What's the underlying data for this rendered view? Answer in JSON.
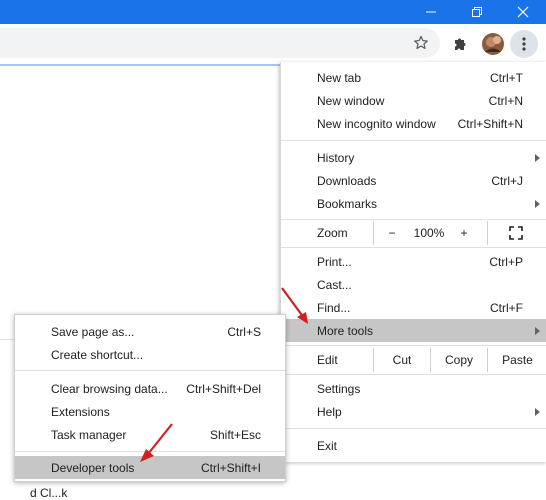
{
  "window": {
    "minimize_icon": "minimize-icon",
    "restore_icon": "restore-icon",
    "close_icon": "close-icon"
  },
  "toolbar": {
    "star_icon": "bookmark-star-icon",
    "extensions_icon": "extensions-puzzle-icon",
    "profile_icon": "avatar",
    "menu_icon": "three-dot-menu-icon"
  },
  "page": {
    "partial_text": "d Cl...k"
  },
  "menu": {
    "new_tab": {
      "label": "New tab",
      "shortcut": "Ctrl+T"
    },
    "new_window": {
      "label": "New window",
      "shortcut": "Ctrl+N"
    },
    "new_incognito": {
      "label": "New incognito window",
      "shortcut": "Ctrl+Shift+N"
    },
    "history": {
      "label": "History"
    },
    "downloads": {
      "label": "Downloads",
      "shortcut": "Ctrl+J"
    },
    "bookmarks": {
      "label": "Bookmarks"
    },
    "zoom": {
      "label": "Zoom",
      "minus": "−",
      "value": "100%",
      "plus": "+"
    },
    "print": {
      "label": "Print...",
      "shortcut": "Ctrl+P"
    },
    "cast": {
      "label": "Cast..."
    },
    "find": {
      "label": "Find...",
      "shortcut": "Ctrl+F"
    },
    "more_tools": {
      "label": "More tools"
    },
    "edit": {
      "label": "Edit",
      "cut": "Cut",
      "copy": "Copy",
      "paste": "Paste"
    },
    "settings": {
      "label": "Settings"
    },
    "help": {
      "label": "Help"
    },
    "exit": {
      "label": "Exit"
    }
  },
  "submenu": {
    "save_page": {
      "label": "Save page as...",
      "shortcut": "Ctrl+S"
    },
    "create_shortcut": {
      "label": "Create shortcut..."
    },
    "clear_browsing": {
      "label": "Clear browsing data...",
      "shortcut": "Ctrl+Shift+Del"
    },
    "extensions": {
      "label": "Extensions"
    },
    "task_manager": {
      "label": "Task manager",
      "shortcut": "Shift+Esc"
    },
    "developer_tools": {
      "label": "Developer tools",
      "shortcut": "Ctrl+Shift+I"
    }
  },
  "colors": {
    "titlebar": "#1a73e8",
    "highlight": "#c6c6c6",
    "annotation_arrow": "#d21f1f"
  }
}
